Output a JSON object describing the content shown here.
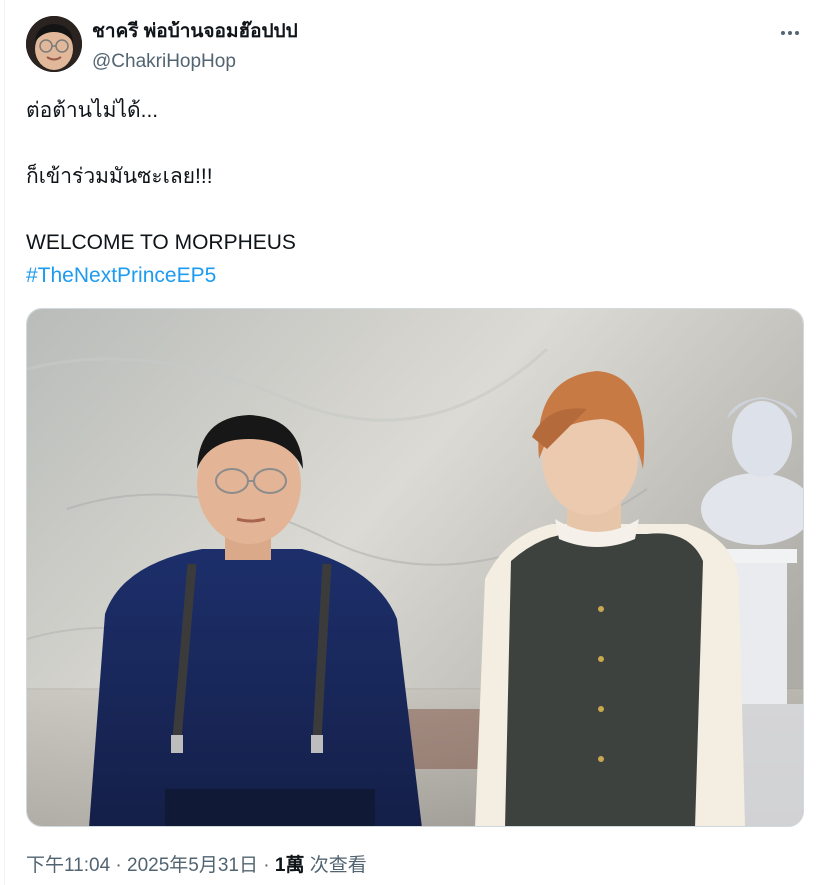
{
  "tweet": {
    "author": {
      "display_name": "ชาครี พ่อบ้านจอมฮ๊อปปป",
      "handle": "@ChakriHopHop",
      "avatar_icon": "profile-avatar"
    },
    "more_icon": "more-horizontal-icon",
    "lines": [
      "ต่อต้านไม่ได้...",
      "ก็เข้าร่วมมันซะเลย!!!",
      "WELCOME TO MORPHEUS"
    ],
    "hashtag": "#TheNextPrinceEP5",
    "media": {
      "kind": "photo"
    },
    "meta": {
      "time": "下午11:04",
      "sep1": " · ",
      "date": "2025年5月31日",
      "sep2": " · ",
      "views_count": "1萬",
      "views_label": " 次查看"
    }
  },
  "colors": {
    "text": "#0f1419",
    "secondary": "#536471",
    "link": "#1d9bf0",
    "border": "#cfd9de"
  }
}
